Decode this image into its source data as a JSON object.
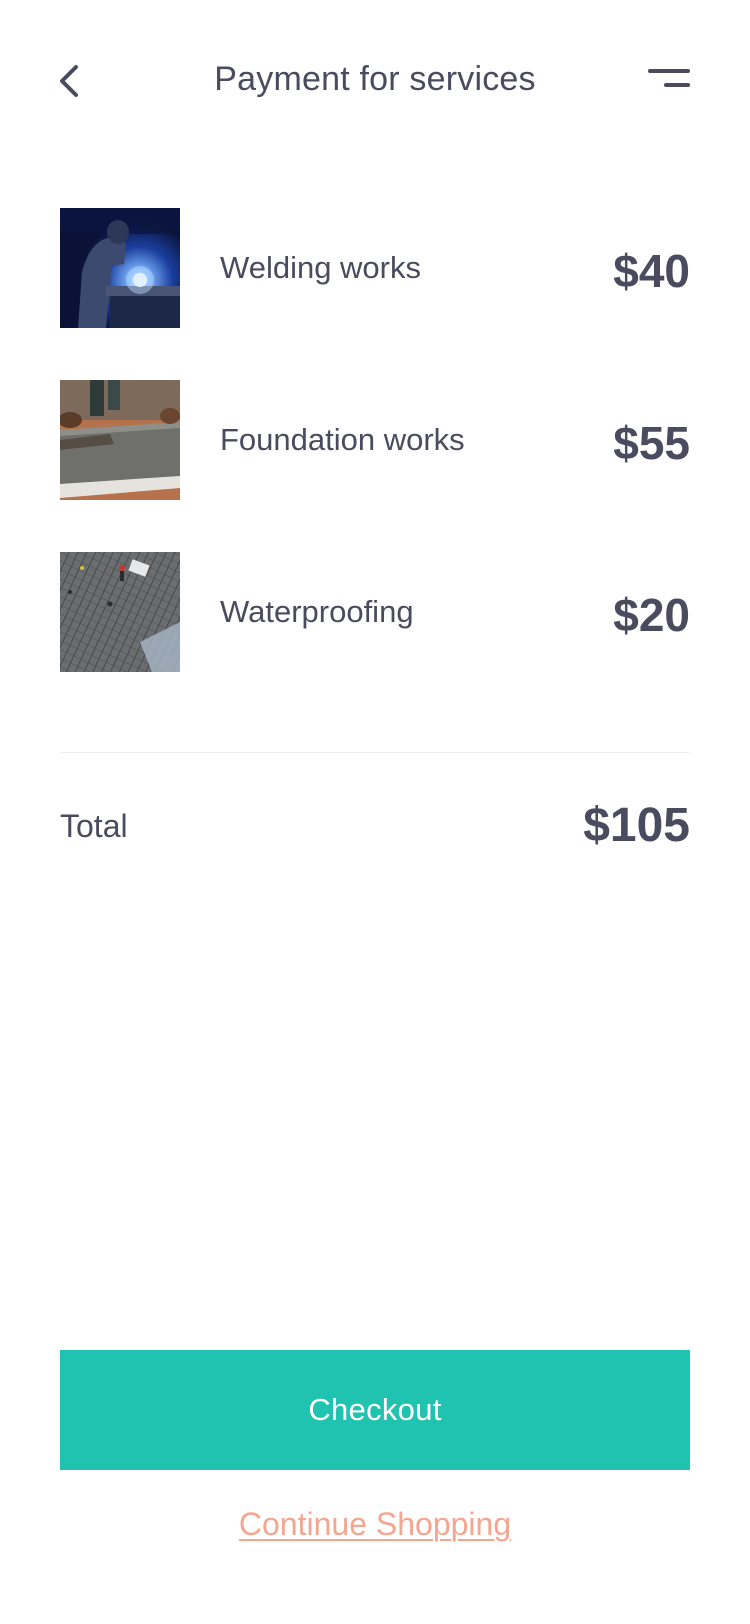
{
  "header": {
    "title": "Payment for services",
    "back_icon": "chevron-left-icon",
    "menu_icon": "menu-icon"
  },
  "services": [
    {
      "name": "Welding works",
      "price": "$40",
      "image": "welding-photo"
    },
    {
      "name": "Foundation works",
      "price": "$55",
      "image": "foundation-photo"
    },
    {
      "name": "Waterproofing",
      "price": "$20",
      "image": "waterproofing-photo"
    }
  ],
  "total": {
    "label": "Total",
    "value": "$105"
  },
  "actions": {
    "checkout_label": "Checkout",
    "continue_label": "Continue Shopping"
  },
  "colors": {
    "text": "#4a4b5e",
    "accent": "#20c3af",
    "link": "#f5a691",
    "divider": "#eeeeee"
  }
}
